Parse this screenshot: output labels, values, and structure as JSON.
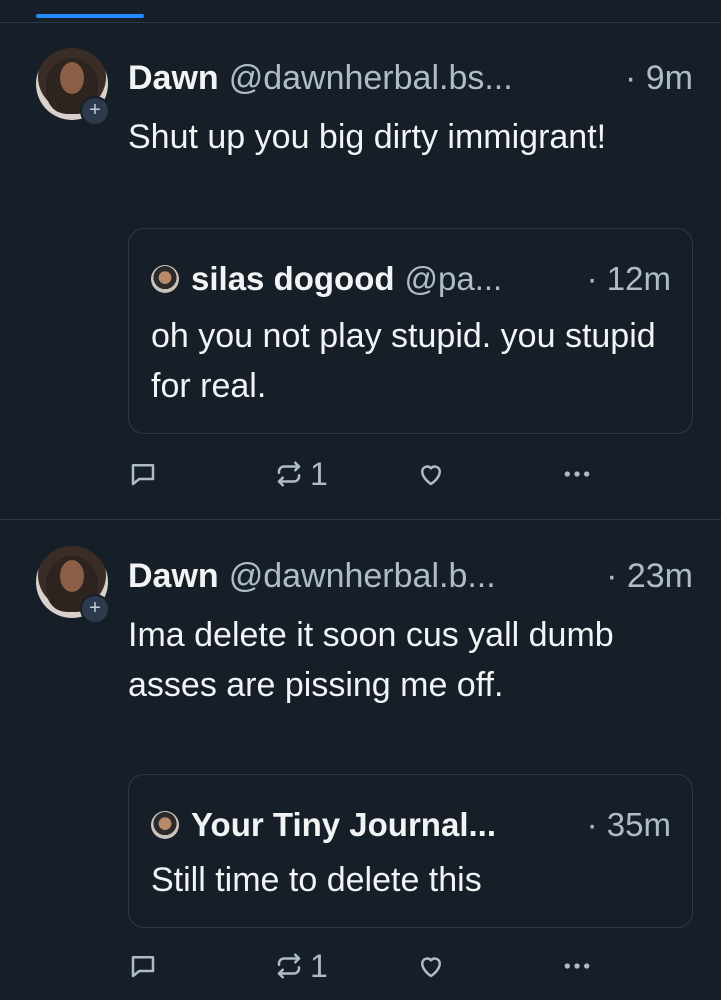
{
  "posts": [
    {
      "author": "Dawn",
      "handle": "@dawnherbal.bs...",
      "time": "· 9m",
      "text": "Shut up you big dirty immigrant!",
      "quote": {
        "author": "silas dogood",
        "handle": "@pa...",
        "time": "· 12m",
        "text": "oh you not play stupid. you stupid for real."
      },
      "repost_count": "1"
    },
    {
      "author": "Dawn",
      "handle": "@dawnherbal.b...",
      "time": "· 23m",
      "text": "Ima delete it soon cus yall dumb asses are pissing me off.",
      "quote": {
        "author": "Your Tiny Journal...",
        "handle": "",
        "time": "· 35m",
        "text": "Still time to delete this"
      },
      "repost_count": "1"
    }
  ],
  "icons": [
    "reply-icon",
    "repost-icon",
    "like-icon",
    "more-icon",
    "follow-plus-icon"
  ],
  "colors": {
    "background": "#161e27",
    "accent": "#208bfe",
    "muted_text": "#aebbc9",
    "border": "#2e3a48"
  }
}
